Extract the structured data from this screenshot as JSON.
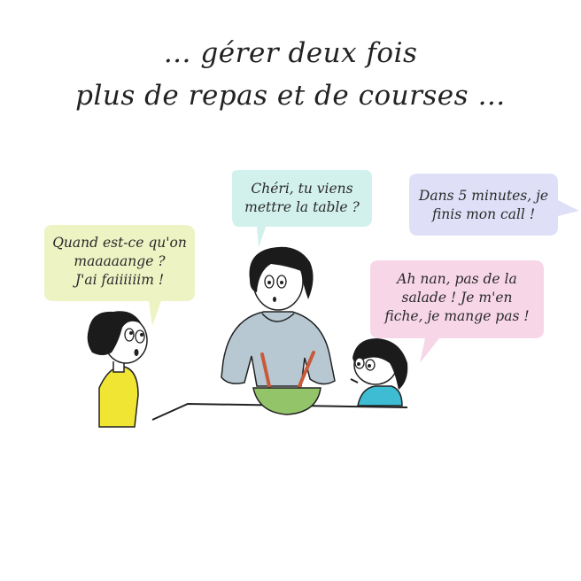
{
  "caption": {
    "line1": "… gérer deux fois",
    "line2": "plus de repas et de courses …"
  },
  "bubbles": {
    "mother": {
      "text": "Chéri, tu viens\nmettre la table ?",
      "color": "#d3f1ec"
    },
    "boy": {
      "text": "Quand est-ce qu'on\nmaaaaange ?\nJ'ai faiiiiiim !",
      "color": "#eef3c4"
    },
    "father_offscreen": {
      "text": "Dans 5 minutes, je\nfinis mon call !",
      "color": "#dfe0f7"
    },
    "girl": {
      "text": "Ah nan, pas de la\nsalade ! Je m'en\nfiche, je mange pas !",
      "color": "#f7d6e7"
    }
  },
  "colors": {
    "boy_shirt": "#f1e534",
    "mother_sweater": "#b7c8d3",
    "salad_bowl": "#94c46a",
    "girl_shirt": "#3dbcd3",
    "hair": "#1b1b1b"
  }
}
